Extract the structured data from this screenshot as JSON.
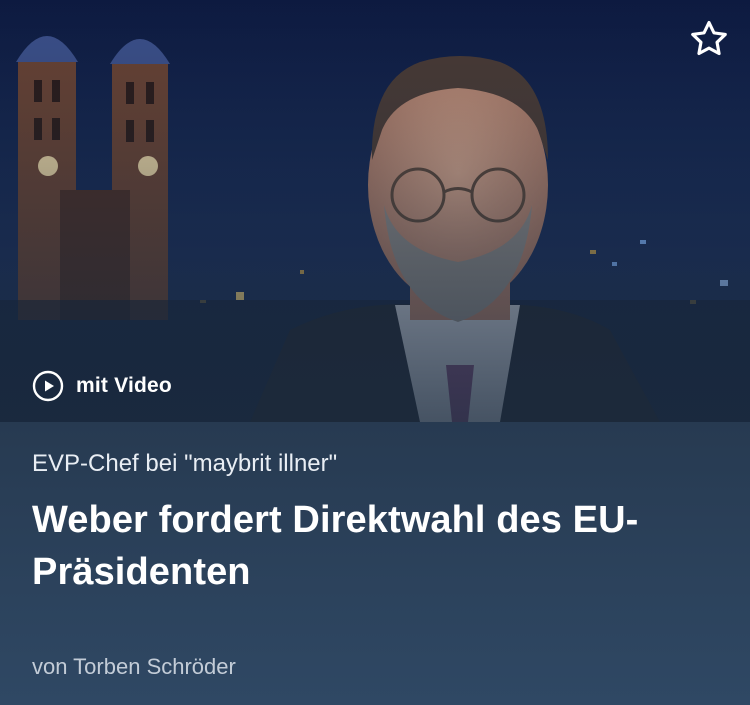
{
  "article": {
    "video_label": "mit Video",
    "kicker": "EVP-Chef bei \"maybrit illner\"",
    "headline": "Weber fordert Direktwahl des EU-Präsidenten",
    "author": "von Torben Schröder"
  },
  "icons": {
    "favorite": "star-outline-icon",
    "play": "play-circle-icon"
  },
  "colors": {
    "background": "#24354a",
    "headline": "#ffffff",
    "kicker": "#e9eef4",
    "author": "#c3ccd7"
  }
}
